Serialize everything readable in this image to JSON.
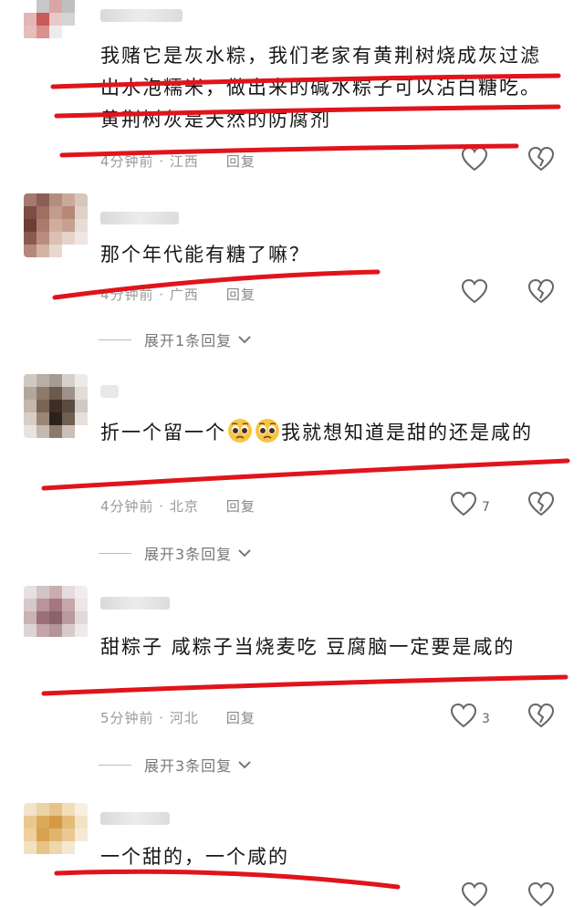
{
  "comments": [
    {
      "text": "我赌它是灰水粽，我们老家有黄荆树烧成灰过滤出水泡糯米，做出来的碱水粽子可以沾白糖吃。黄荆树灰是天然的防腐剂",
      "time": "4分钟前 · 江西",
      "reply_label": "回复",
      "likes": "",
      "expand": ""
    },
    {
      "text": "那个年代能有糖了嘛？",
      "time": "4分钟前 · 广西",
      "reply_label": "回复",
      "likes": "",
      "expand": "展开1条回复"
    },
    {
      "text_before": "折一个留一个",
      "text_after": "我就想知道是甜的还是咸的",
      "time": "4分钟前 · 北京",
      "reply_label": "回复",
      "likes": "7",
      "expand": "展开3条回复"
    },
    {
      "text": "甜粽子 咸粽子当烧麦吃 豆腐脑一定要是咸的",
      "time": "5分钟前 · 河北",
      "reply_label": "回复",
      "likes": "3",
      "expand": "展开3条回复"
    },
    {
      "text": "一个甜的，一个咸的",
      "time": "",
      "reply_label": "",
      "likes": "",
      "expand": ""
    }
  ],
  "colors": {
    "annotation_red": "#e0141c",
    "meta_gray": "#9a9a9a"
  },
  "icons": [
    "heart-icon",
    "broken-heart-icon",
    "chevron-down-icon",
    "pleading-face-emoji-icon"
  ]
}
